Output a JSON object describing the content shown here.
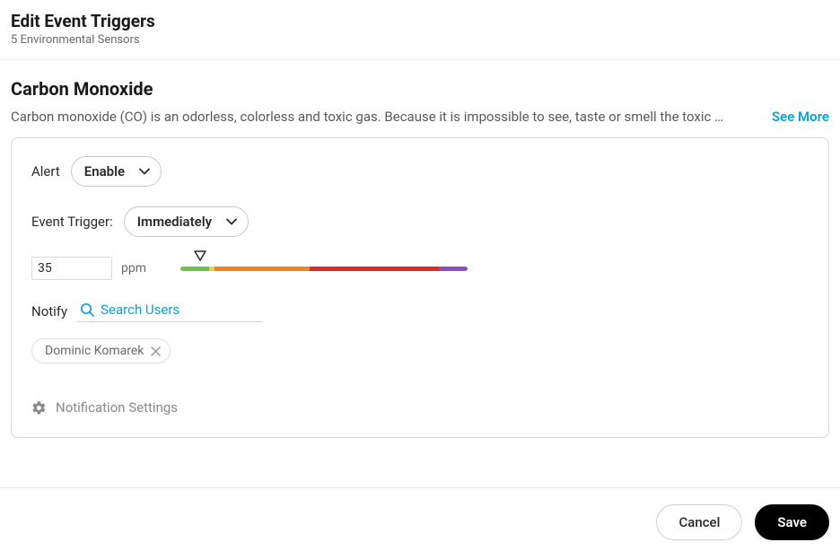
{
  "header": {
    "title": "Edit Event Triggers",
    "subtitle": "5 Environmental Sensors"
  },
  "section": {
    "title": "Carbon Monoxide",
    "description": "Carbon monoxide (CO) is an odorless, colorless and toxic gas. Because it is impossible to see, taste or smell the toxic …",
    "see_more": "See More"
  },
  "alert": {
    "label": "Alert",
    "value": "Enable"
  },
  "event_trigger": {
    "label": "Event Trigger:",
    "value": "Immediately"
  },
  "threshold": {
    "value": "35",
    "unit": "ppm"
  },
  "notify": {
    "label": "Notify",
    "search_placeholder": "Search Users",
    "users": [
      {
        "name": "Dominic Komarek"
      }
    ]
  },
  "notification_settings": "Notification Settings",
  "footer": {
    "cancel": "Cancel",
    "save": "Save"
  },
  "colors": {
    "link": "#0aa2d9",
    "muted": "#6a6a6a",
    "border": "#d9d9d9"
  }
}
